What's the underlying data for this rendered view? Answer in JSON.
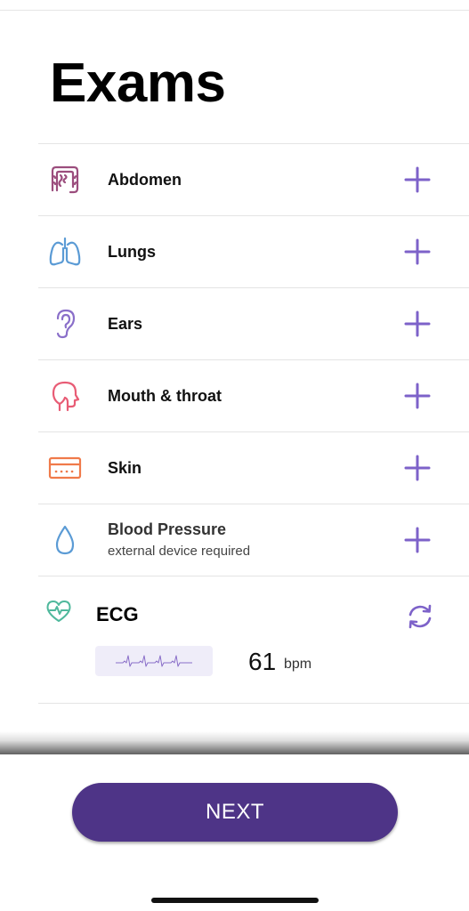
{
  "page": {
    "title": "Exams"
  },
  "exams": [
    {
      "label": "Abdomen",
      "sub": "",
      "icon": "intestine-icon",
      "color": "#9b4d7d"
    },
    {
      "label": "Lungs",
      "sub": "",
      "icon": "lungs-icon",
      "color": "#5b9bd5"
    },
    {
      "label": "Ears",
      "sub": "",
      "icon": "ear-icon",
      "color": "#8a6fc9"
    },
    {
      "label": "Mouth & throat",
      "sub": "",
      "icon": "head-profile-icon",
      "color": "#e85c75"
    },
    {
      "label": "Skin",
      "sub": "",
      "icon": "skin-layer-icon",
      "color": "#f07a4a"
    },
    {
      "label": "Blood Pressure",
      "sub": "external device required",
      "icon": "drop-icon",
      "color": "#5b9bd5"
    }
  ],
  "ecg": {
    "title": "ECG",
    "value": "61",
    "unit": "bpm",
    "heart_icon": "heart-pulse-icon",
    "refresh_icon": "refresh-icon",
    "accent": "#7d62c9"
  },
  "actions": {
    "add_icon": "plus-icon",
    "add_color": "#7d62c9",
    "next_label": "NEXT",
    "next_color": "#4e3487"
  }
}
